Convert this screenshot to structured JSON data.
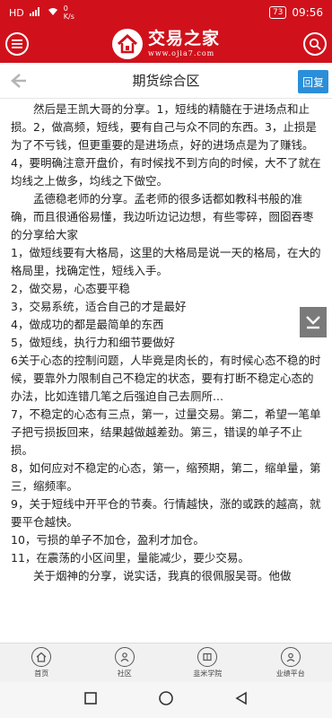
{
  "status_bar": {
    "left_text": "HD",
    "speed": "0",
    "speed_unit": "K/s",
    "battery": "73",
    "time": "09:56"
  },
  "header": {
    "logo_title": "交易之家",
    "logo_url": "www.ojia7.com"
  },
  "nav": {
    "title": "期货综合区",
    "reply_label": "回复"
  },
  "content": {
    "paragraphs": [
      {
        "text": "然后是王凯大哥的分享。1，短线的精髓在于进场点和止损。2，做高频，短线，要有自己与众不同的东西。3，止损是为了不亏钱，但更重要的是进场点，好的进场点是为了赚钱。4，要明确注意开盘价，有时候找不到方向的时候，大不了就在均线之上做多，均线之下做空。",
        "indent": true
      },
      {
        "text": "孟德稳老师的分享。孟老师的很多话都如教科书般的准确，而且很通俗易懂，我边听边记边想，有些零碎，囫囵吞枣的分享给大家",
        "indent": true
      },
      {
        "text": "1，做短线要有大格局，这里的大格局是说一天的格局，在大的格局里，找确定性，短线入手。",
        "indent": false
      },
      {
        "text": "2，做交易，心态要平稳",
        "indent": false
      },
      {
        "text": "3，交易系统，适合自己的才是最好",
        "indent": false
      },
      {
        "text": "4，做成功的都是最简单的东西",
        "indent": false
      },
      {
        "text": "5，做短线，执行力和细节要做好",
        "indent": false
      },
      {
        "text": "6关于心态的控制问题，人毕竟是肉长的，有时候心态不稳的时候，要靠外力限制自己不稳定的状态，要有打断不稳定心态的办法，比如连错几笔之后强迫自己去厕所...",
        "indent": false
      },
      {
        "text": "7，不稳定的心态有三点，第一，过量交易。第二，希望一笔单子把亏损扳回来，结果越做越差劲。第三，错误的单子不止损。",
        "indent": false
      },
      {
        "text": "8，如何应对不稳定的心态，第一，缩预期，第二，缩单量，第三，缩频率。",
        "indent": false
      },
      {
        "text": "9，关于短线中开平仓的节奏。行情越快，涨的或跌的越高，就要平仓越快。",
        "indent": false
      },
      {
        "text": "10，亏损的单子不加仓，盈利才加仓。",
        "indent": false
      },
      {
        "text": "11，在震荡的小区间里，量能减少，要少交易。",
        "indent": false
      },
      {
        "text": "关于烟神的分享，说实话，我真的很佩服吴哥。他做",
        "indent": true
      }
    ]
  },
  "tab_bar": {
    "tabs": [
      {
        "label": "首页",
        "icon": "home-icon"
      },
      {
        "label": "社区",
        "icon": "community-icon"
      },
      {
        "label": "韭米学院",
        "icon": "academy-icon"
      },
      {
        "label": "业绩平台",
        "icon": "performance-icon"
      }
    ]
  },
  "colors": {
    "brand_red": "#d0111b",
    "reply_blue": "#2b8ed8"
  }
}
